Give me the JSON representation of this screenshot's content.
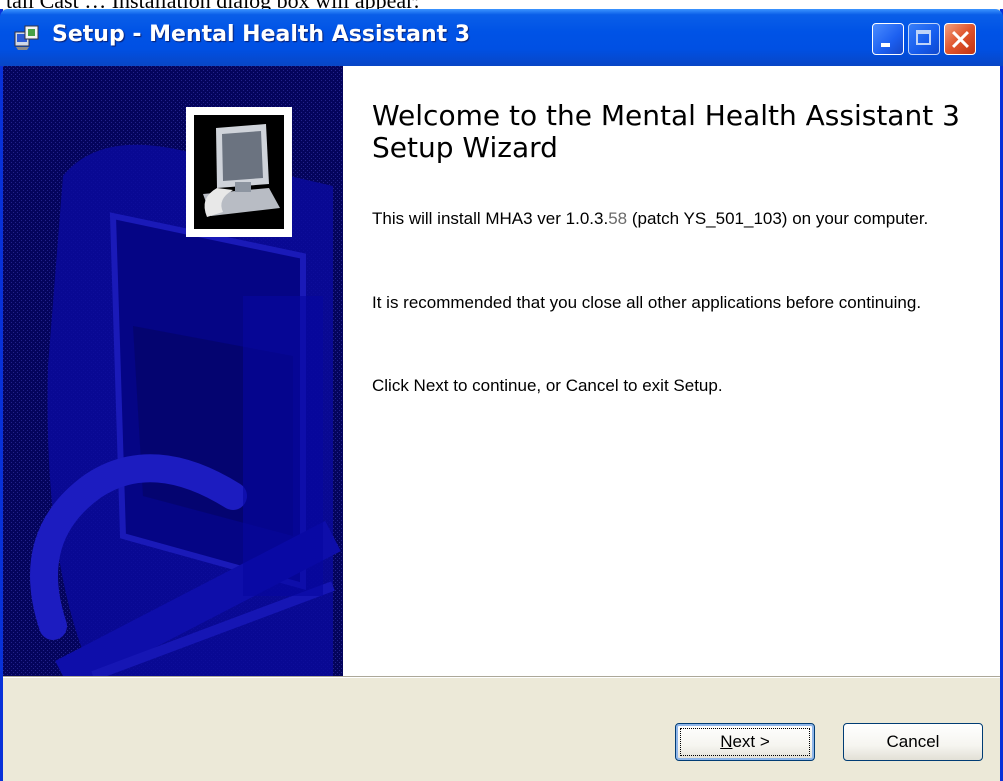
{
  "caption": {
    "text": "tall Cast … Installation dialog box will appear:"
  },
  "window": {
    "title": "Setup - Mental Health Assistant 3",
    "icon": "setup-installer-icon"
  },
  "sidebar": {
    "icon": "computer-install-icon"
  },
  "content": {
    "heading": "Welcome to the Mental Health Assistant 3 Setup Wizard",
    "para1": {
      "before": "This will install MHA3 ver 1.0.3.",
      "accent": "58",
      "after": " (patch YS_501_103) on your computer."
    },
    "para2": "It is recommended that you close all other applications before continuing.",
    "para3": "Click Next to continue, or Cancel to exit Setup."
  },
  "buttons": {
    "next": {
      "accel": "N",
      "rest": "ext >"
    },
    "cancel": "Cancel"
  },
  "colors": {
    "titlebar": "#0053e6",
    "sidebar": "#04045c",
    "close_button": "#e0542c"
  }
}
